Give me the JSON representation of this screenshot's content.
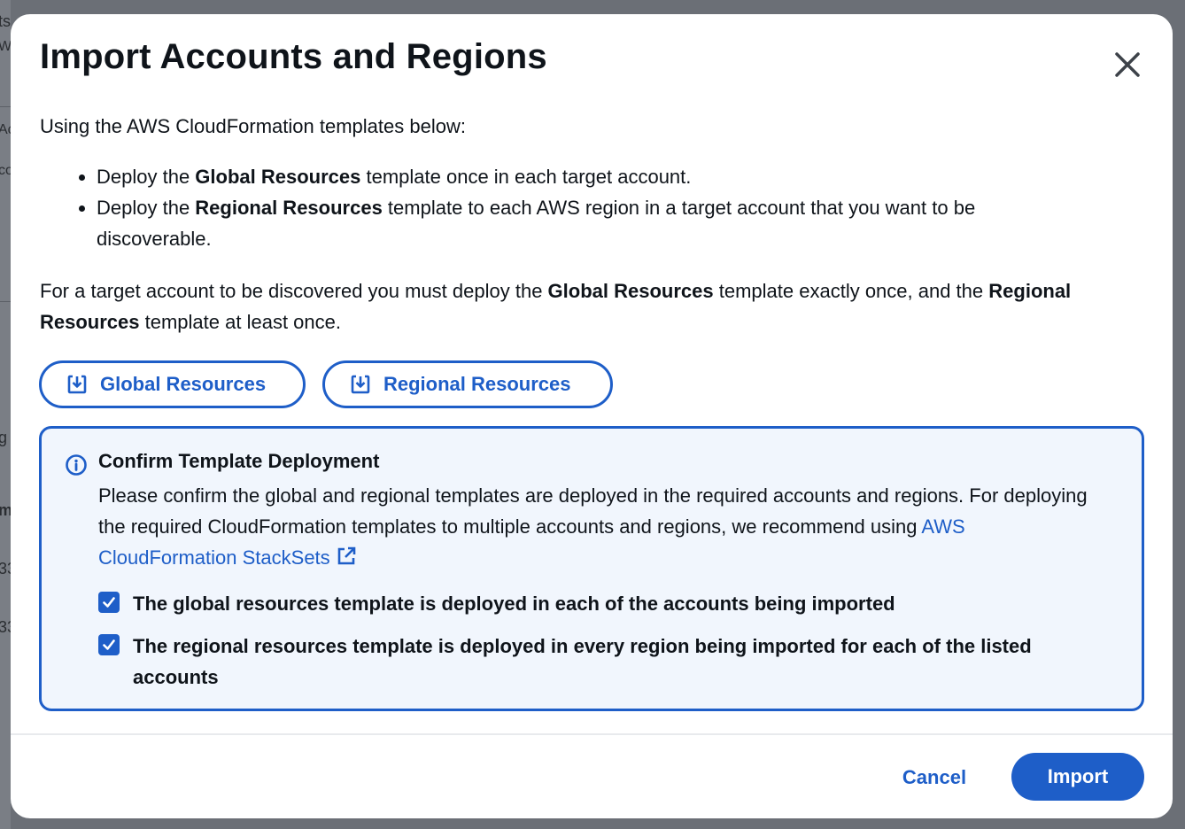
{
  "background": {
    "fragments": [
      "ts",
      "W",
      "Ac",
      "co",
      "g",
      "m",
      "33",
      "33"
    ]
  },
  "modal": {
    "title": "Import Accounts and Regions",
    "close_icon": "close-icon",
    "intro": "Using the AWS CloudFormation templates below:",
    "bullets": [
      {
        "prefix": "Deploy the ",
        "bold": "Global Resources",
        "suffix": " template once in each target account."
      },
      {
        "prefix": "Deploy the ",
        "bold": "Regional Resources",
        "suffix": " template to each AWS region in a target account that you want to be discoverable."
      }
    ],
    "paragraph": {
      "p1": "For a target account to be discovered you must deploy the ",
      "b1": "Global Resources",
      "p2": " template exactly once, and the ",
      "b2": "Regional Resources",
      "p3": " template at least once."
    },
    "buttons": {
      "global": "Global Resources",
      "regional": "Regional Resources",
      "icon": "download-icon"
    },
    "alert": {
      "icon": "info-icon",
      "title": "Confirm Template Deployment",
      "text": "Please confirm the global and regional templates are deployed in the required accounts and regions. For deploying the required CloudFormation templates to multiple accounts and regions, we recommend using ",
      "link": "AWS CloudFormation StackSets",
      "link_icon": "external-link-icon",
      "checkboxes": [
        {
          "label": "The global resources template is deployed in each of the accounts being imported",
          "checked": true
        },
        {
          "label": "The regional resources template is deployed in every region being imported for each of the listed accounts",
          "checked": true
        }
      ]
    },
    "footer": {
      "cancel": "Cancel",
      "import": "Import"
    }
  },
  "colors": {
    "accent": "#1e5ec8",
    "alert_bg": "#f1f6fd",
    "overlay": "#6b6f76"
  }
}
